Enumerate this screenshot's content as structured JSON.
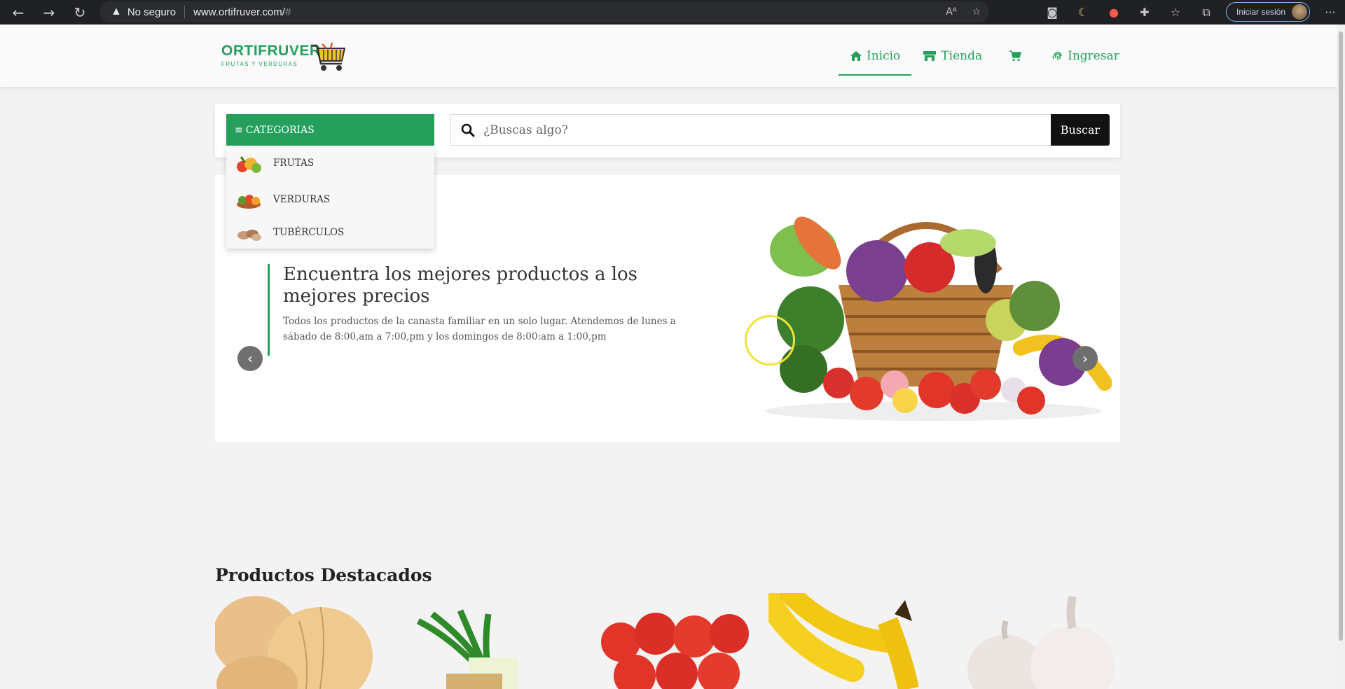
{
  "browser": {
    "insecure_label": "No seguro",
    "url": "www.ortifruver.com/",
    "url_hash": "#",
    "signin_label": "Iniciar sesión",
    "more_label": "···"
  },
  "header": {
    "logo_text": "ORTIFRUVER",
    "logo_subtitle": "FRUTAS Y VERDURAS",
    "nav": {
      "inicio": "Inicio",
      "tienda": "Tienda",
      "ingresar": "Ingresar"
    },
    "brand_color": "#24a05c"
  },
  "search": {
    "categories_label": "CATEGORIAS",
    "placeholder": "¿Buscas algo?",
    "button_label": "Buscar"
  },
  "categories": [
    {
      "label": "FRUTAS",
      "icon": "fruits-icon"
    },
    {
      "label": "VERDURAS",
      "icon": "vegetables-icon"
    },
    {
      "label": "TUBÉRCULOS",
      "icon": "tubers-icon"
    }
  ],
  "hero": {
    "title": "Encuentra los mejores productos a los mejores precios",
    "description": "Todos los productos de la canasta familiar en un solo lugar. Atendemos de lunes a sábado de 8:00,am a 7:00,pm y los domingos de 8:00:am a 1:00,pm"
  },
  "featured": {
    "title": "Productos Destacados",
    "products": [
      {
        "name": "cebolla"
      },
      {
        "name": "cebolla larga"
      },
      {
        "name": "tomate"
      },
      {
        "name": "banano"
      },
      {
        "name": "ajo"
      }
    ]
  }
}
